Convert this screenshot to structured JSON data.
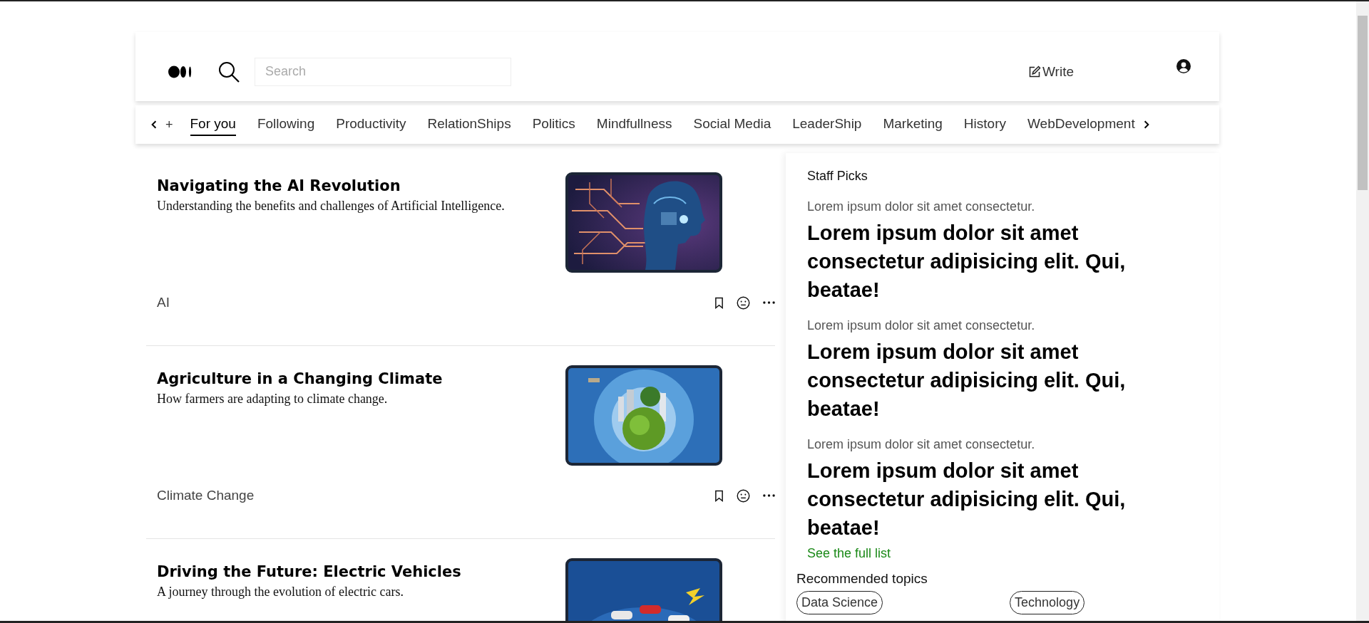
{
  "header": {
    "search": {
      "placeholder": "Search"
    },
    "write_label": "Write"
  },
  "topics_nav": {
    "add_symbol": "+",
    "items": [
      {
        "label": "For you",
        "selected": true
      },
      {
        "label": "Following",
        "selected": false
      },
      {
        "label": "Productivity",
        "selected": false
      },
      {
        "label": "RelationShips",
        "selected": false
      },
      {
        "label": "Politics",
        "selected": false
      },
      {
        "label": "Mindfullness",
        "selected": false
      },
      {
        "label": "Social Media",
        "selected": false
      },
      {
        "label": "LeaderShip",
        "selected": false
      },
      {
        "label": "Marketing",
        "selected": false
      },
      {
        "label": "History",
        "selected": false
      },
      {
        "label": "WebDevelopment",
        "selected": false
      }
    ]
  },
  "articles": [
    {
      "title": "Navigating the AI Revolution",
      "subtitle": "Understanding the benefits and challenges of Artificial Intelligence.",
      "tag": "AI"
    },
    {
      "title": "Agriculture in a Changing Climate",
      "subtitle": "How farmers are adapting to climate change.",
      "tag": "Climate Change"
    },
    {
      "title": "Driving the Future: Electric Vehicles",
      "subtitle": "A journey through the evolution of electric cars."
    }
  ],
  "staff_picks": {
    "title": "Staff Picks",
    "items": [
      {
        "kicker": "Lorem ipsum dolor sit amet consectetur.",
        "headline": "Lorem ipsum dolor sit amet consectetur adipisicing elit. Qui, beatae!"
      },
      {
        "kicker": "Lorem ipsum dolor sit amet consectetur.",
        "headline": "Lorem ipsum dolor sit amet consectetur adipisicing elit. Qui, beatae!"
      },
      {
        "kicker": "Lorem ipsum dolor sit amet consectetur.",
        "headline": "Lorem ipsum dolor sit amet consectetur adipisicing elit. Qui, beatae!"
      }
    ],
    "link": "See the full list"
  },
  "recommended": {
    "title": "Recommended topics",
    "topics": [
      "Data Science",
      "Technology"
    ]
  }
}
